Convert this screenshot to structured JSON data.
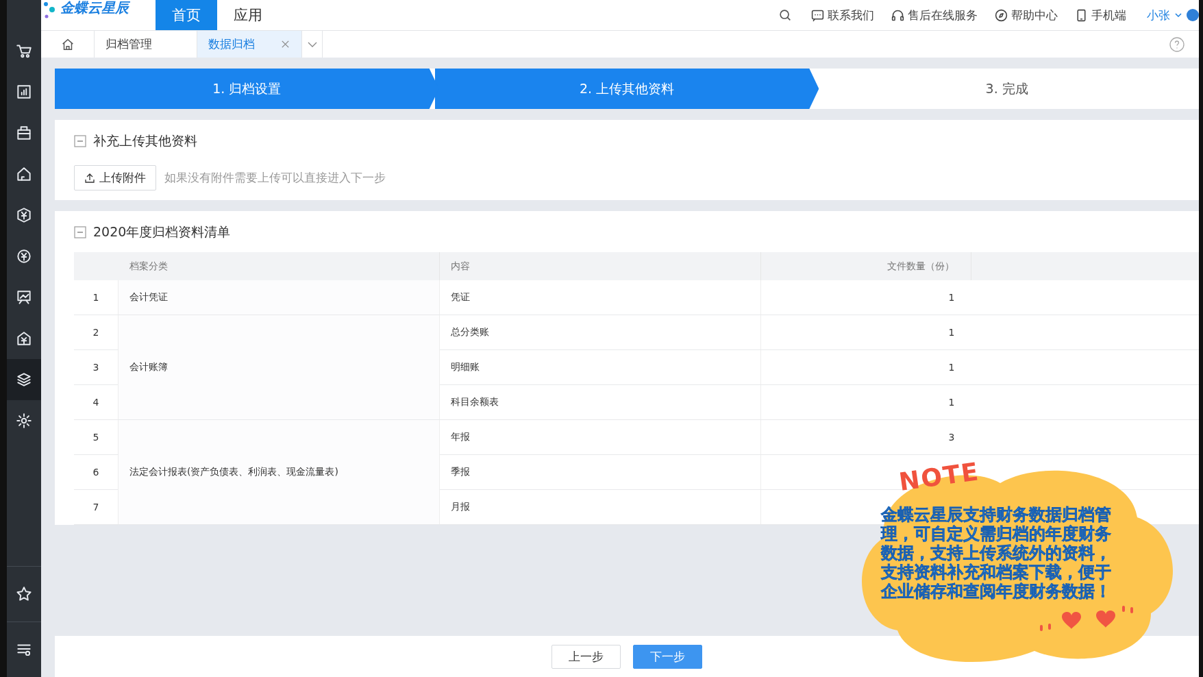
{
  "header": {
    "logo": "金蝶云星辰",
    "nav": [
      {
        "label": "首页",
        "selected": true
      },
      {
        "label": "应用",
        "selected": false
      }
    ],
    "links": [
      {
        "kind": "chat",
        "label": "联系我们"
      },
      {
        "kind": "headset",
        "label": "售后在线服务"
      },
      {
        "kind": "compass",
        "label": "帮助中心"
      },
      {
        "kind": "phone",
        "label": "手机端"
      }
    ],
    "user": "小张"
  },
  "sidebar": {
    "items": [
      {
        "kind": "cart",
        "selected": false
      },
      {
        "kind": "chart",
        "selected": false
      },
      {
        "kind": "bag",
        "selected": false
      },
      {
        "kind": "house",
        "selected": false
      },
      {
        "kind": "yen-shield",
        "selected": false
      },
      {
        "kind": "yen-circle",
        "selected": false
      },
      {
        "kind": "board",
        "selected": false
      },
      {
        "kind": "yen-house",
        "selected": false
      },
      {
        "kind": "layers",
        "selected": true
      },
      {
        "kind": "gear",
        "selected": false
      }
    ],
    "bottom_items": [
      {
        "kind": "star",
        "selected": false
      },
      {
        "kind": "filter",
        "selected": false
      }
    ]
  },
  "tabs": [
    {
      "label": "归档管理",
      "selected": false,
      "closable": false
    },
    {
      "label": "数据归档",
      "selected": true,
      "closable": true
    }
  ],
  "steps": [
    {
      "label": "1. 归档设置",
      "reached": true
    },
    {
      "label": "2. 上传其他资料",
      "reached": true
    },
    {
      "label": "3. 完成",
      "reached": false
    }
  ],
  "upload_section": {
    "title": "补充上传其他资料",
    "expanded": true,
    "button": "上传附件",
    "hint": "如果没有附件需要上传可以直接进入下一步"
  },
  "archive_section": {
    "title": "2020年度归档资料清单",
    "expanded": true,
    "columns": [
      "档案分类",
      "内容",
      "文件数量（份）"
    ],
    "groups": [
      {
        "category": "会计凭证",
        "rows": [
          {
            "index": "1",
            "content": "凭证",
            "count": "1"
          }
        ]
      },
      {
        "category": "会计账簿",
        "rows": [
          {
            "index": "2",
            "content": "总分类账",
            "count": "1"
          },
          {
            "index": "3",
            "content": "明细账",
            "count": "1"
          },
          {
            "index": "4",
            "content": "科目余额表",
            "count": "1"
          }
        ]
      },
      {
        "category": "法定会计报表(资产负债表、利润表、现金流量表)",
        "rows": [
          {
            "index": "5",
            "content": "年报",
            "count": "3"
          },
          {
            "index": "6",
            "content": "季报"
          },
          {
            "index": "7",
            "content": "月报"
          }
        ]
      }
    ]
  },
  "note": {
    "title": "NOTE",
    "text": "金蝶云星辰支持财务数据归档管理，可自定义需归档的年度财务数据，支持上传系统外的资料，支持资料补充和档案下载，便于企业储存和查阅年度财务数据！"
  },
  "footer": {
    "buttons": [
      {
        "label": "上一步",
        "primary": false
      },
      {
        "label": "下一步",
        "primary": true
      }
    ]
  }
}
